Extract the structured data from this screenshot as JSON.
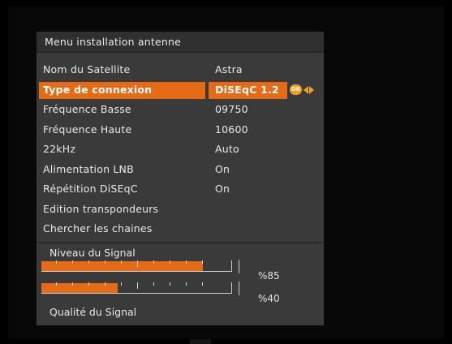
{
  "menu": {
    "title": "Menu installation antenne",
    "items": [
      {
        "label": "Nom du Satellite",
        "value": "Astra"
      },
      {
        "label": "Type de connexion",
        "value": "DiSEqC 1.2",
        "selected": true
      },
      {
        "label": "Fréquence Basse",
        "value": "09750"
      },
      {
        "label": "Fréquence Haute",
        "value": "10600"
      },
      {
        "label": "22kHz",
        "value": "Auto"
      },
      {
        "label": "Alimentation LNB",
        "value": "On"
      },
      {
        "label": "Répétition DiSEqC",
        "value": "On"
      },
      {
        "label": "Edition transpondeurs",
        "value": ""
      },
      {
        "label": "Chercher les chaines",
        "value": ""
      }
    ],
    "nav_hint": {
      "ok_label": "OK",
      "icons": [
        "ok-icon",
        "arrow-left-icon",
        "arrow-right-icon"
      ]
    }
  },
  "signal": {
    "level_label": "Niveau du Signal",
    "level_percent": 85,
    "level_text": "%85",
    "quality_label": "Qualité du Signal",
    "quality_percent": 40,
    "quality_text": "%40"
  },
  "colors": {
    "accent": "#e66b17",
    "panel_bg": "#3a3a3a",
    "text": "#e8e8e8",
    "ok_badge": "#f0a020"
  }
}
